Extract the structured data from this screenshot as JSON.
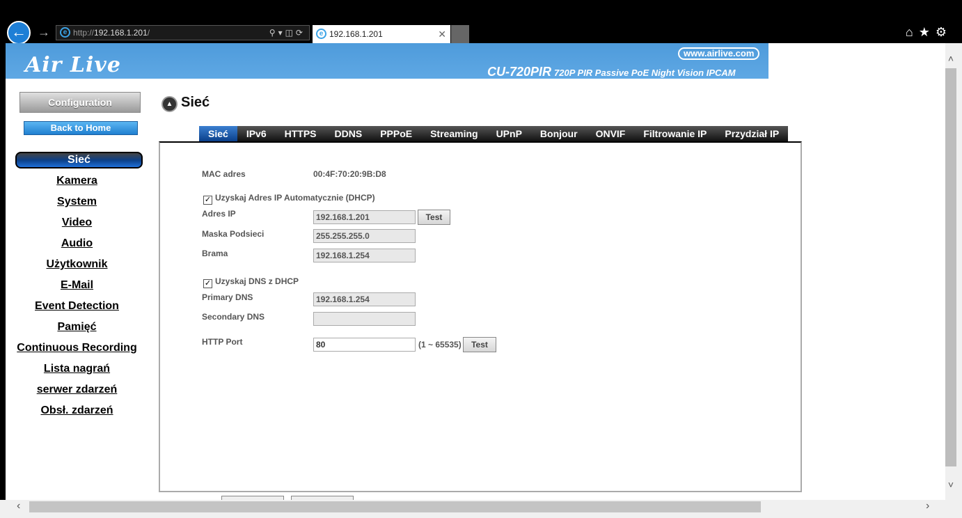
{
  "browser": {
    "url_prefix": "http://",
    "url_host": "192.168.1.201",
    "url_suffix": "/",
    "tab_title": "192.168.1.201"
  },
  "banner": {
    "logo": "Air Live",
    "site": "www.airlive.com",
    "model": "CU-720PIR",
    "description": "720P PIR Passive PoE Night Vision IPCAM"
  },
  "sidebar": {
    "config_label": "Configuration",
    "home_label": "Back to Home",
    "items": [
      {
        "label": "Sieć",
        "active": true
      },
      {
        "label": "Kamera"
      },
      {
        "label": "System"
      },
      {
        "label": "Video"
      },
      {
        "label": "Audio"
      },
      {
        "label": "Użytkownik"
      },
      {
        "label": "E-Mail"
      },
      {
        "label": "Event Detection"
      },
      {
        "label": "Pamięć"
      },
      {
        "label": "Continuous Recording"
      },
      {
        "label": "Lista nagrań"
      },
      {
        "label": "serwer zdarzeń"
      },
      {
        "label": "Obsł. zdarzeń"
      }
    ]
  },
  "page_title": "Sieć",
  "tabs": [
    "Sieć",
    "IPv6",
    "HTTPS",
    "DDNS",
    "PPPoE",
    "Streaming",
    "UPnP",
    "Bonjour",
    "ONVIF",
    "Filtrowanie IP",
    "Przydział IP"
  ],
  "form": {
    "mac_label": "MAC adres",
    "mac_value": "00:4F:70:20:9B:D8",
    "dhcp_label": "Uzyskaj Adres IP Automatycznie (DHCP)",
    "ip_label": "Adres IP",
    "ip_value": "192.168.1.201",
    "test_label": "Test",
    "mask_label": "Maska Podsieci",
    "mask_value": "255.255.255.0",
    "gateway_label": "Brama",
    "gateway_value": "192.168.1.254",
    "dns_dhcp_label": "Uzyskaj DNS z DHCP",
    "primary_dns_label": "Primary DNS",
    "primary_dns_value": "192.168.1.254",
    "secondary_dns_label": "Secondary DNS",
    "secondary_dns_value": "",
    "http_port_label": "HTTP Port",
    "http_port_value": "80",
    "http_port_range": "(1 ~ 65535)"
  }
}
